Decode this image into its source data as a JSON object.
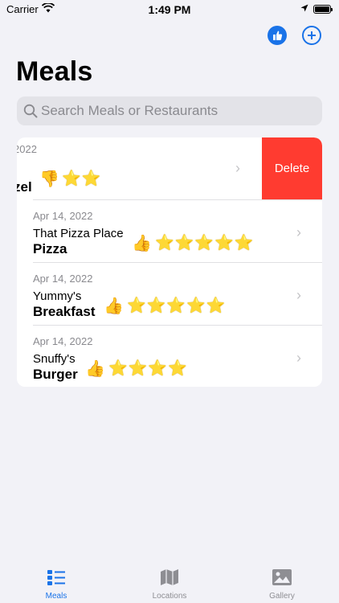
{
  "status_bar": {
    "carrier": "Carrier",
    "time": "1:49 PM"
  },
  "header": {
    "title": "Meals"
  },
  "search": {
    "placeholder": "Search Meals or Restaurants"
  },
  "meals": [
    {
      "date": "2022",
      "restaurant": "",
      "meal": "zel",
      "liked": false,
      "stars": "⭐⭐",
      "swiped": true,
      "delete_label": "Delete"
    },
    {
      "date": "Apr 14, 2022",
      "restaurant": "That Pizza Place",
      "meal": "Pizza",
      "liked": true,
      "stars": "⭐⭐⭐⭐⭐"
    },
    {
      "date": "Apr 14, 2022",
      "restaurant": "Yummy's",
      "meal": "Breakfast",
      "liked": true,
      "stars": "⭐⭐⭐⭐⭐"
    },
    {
      "date": "Apr 14, 2022",
      "restaurant": "Snuffy's",
      "meal": "Burger",
      "liked": true,
      "stars": "⭐⭐⭐⭐"
    }
  ],
  "tabs": [
    {
      "label": "Meals",
      "icon": "list-icon",
      "active": true
    },
    {
      "label": "Locations",
      "icon": "map-icon",
      "active": false
    },
    {
      "label": "Gallery",
      "icon": "photo-icon",
      "active": false
    }
  ],
  "colors": {
    "accent": "#1a73e8",
    "delete": "#ff3b30",
    "background": "#f2f2f7"
  }
}
